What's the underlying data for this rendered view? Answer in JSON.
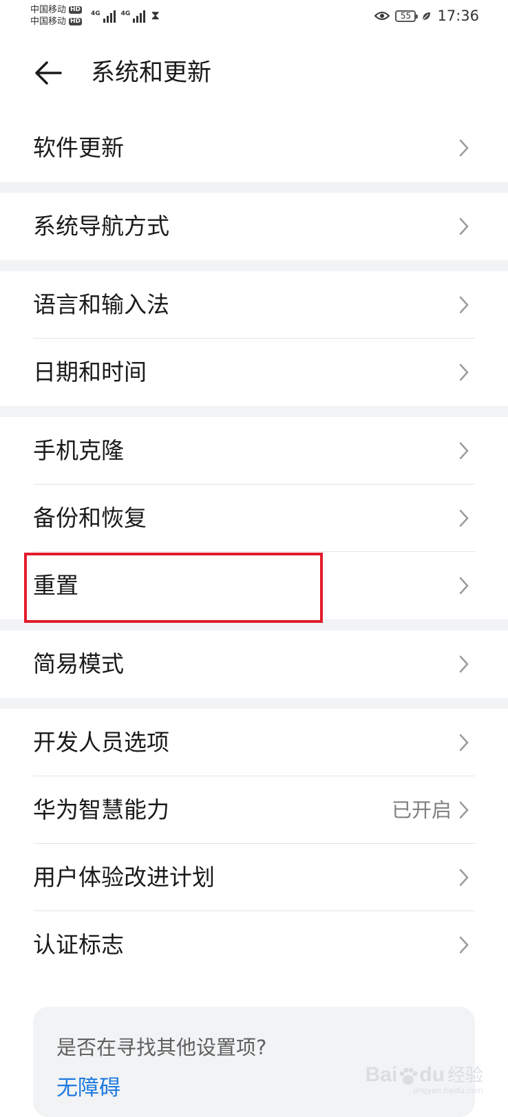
{
  "status_bar": {
    "carrier_1": "中国移动",
    "carrier_2": "中国移动",
    "hd_badge": "HD",
    "network_1": "4G",
    "network_2": "4G",
    "battery_level": "55",
    "time": "17:36"
  },
  "header": {
    "title": "系统和更新"
  },
  "groups": [
    {
      "items": [
        {
          "label": "软件更新"
        }
      ]
    },
    {
      "items": [
        {
          "label": "系统导航方式"
        }
      ]
    },
    {
      "items": [
        {
          "label": "语言和输入法"
        },
        {
          "label": "日期和时间"
        }
      ]
    },
    {
      "items": [
        {
          "label": "手机克隆"
        },
        {
          "label": "备份和恢复"
        },
        {
          "label": "重置"
        }
      ]
    },
    {
      "items": [
        {
          "label": "简易模式"
        }
      ]
    },
    {
      "items": [
        {
          "label": "开发人员选项"
        },
        {
          "label": "华为智慧能力",
          "value": "已开启"
        },
        {
          "label": "用户体验改进计划"
        },
        {
          "label": "认证标志"
        }
      ]
    }
  ],
  "suggestion": {
    "question": "是否在寻找其他设置项?",
    "link": "无障碍"
  },
  "watermark": {
    "brand_left": "Bai",
    "brand_right": "du",
    "brand_cn": "经验",
    "url": "jingyan.baidu.com"
  },
  "colors": {
    "accent_link": "#1e7ae0",
    "highlight_box": "#e21b2b",
    "separator": "#f1f3f5"
  }
}
